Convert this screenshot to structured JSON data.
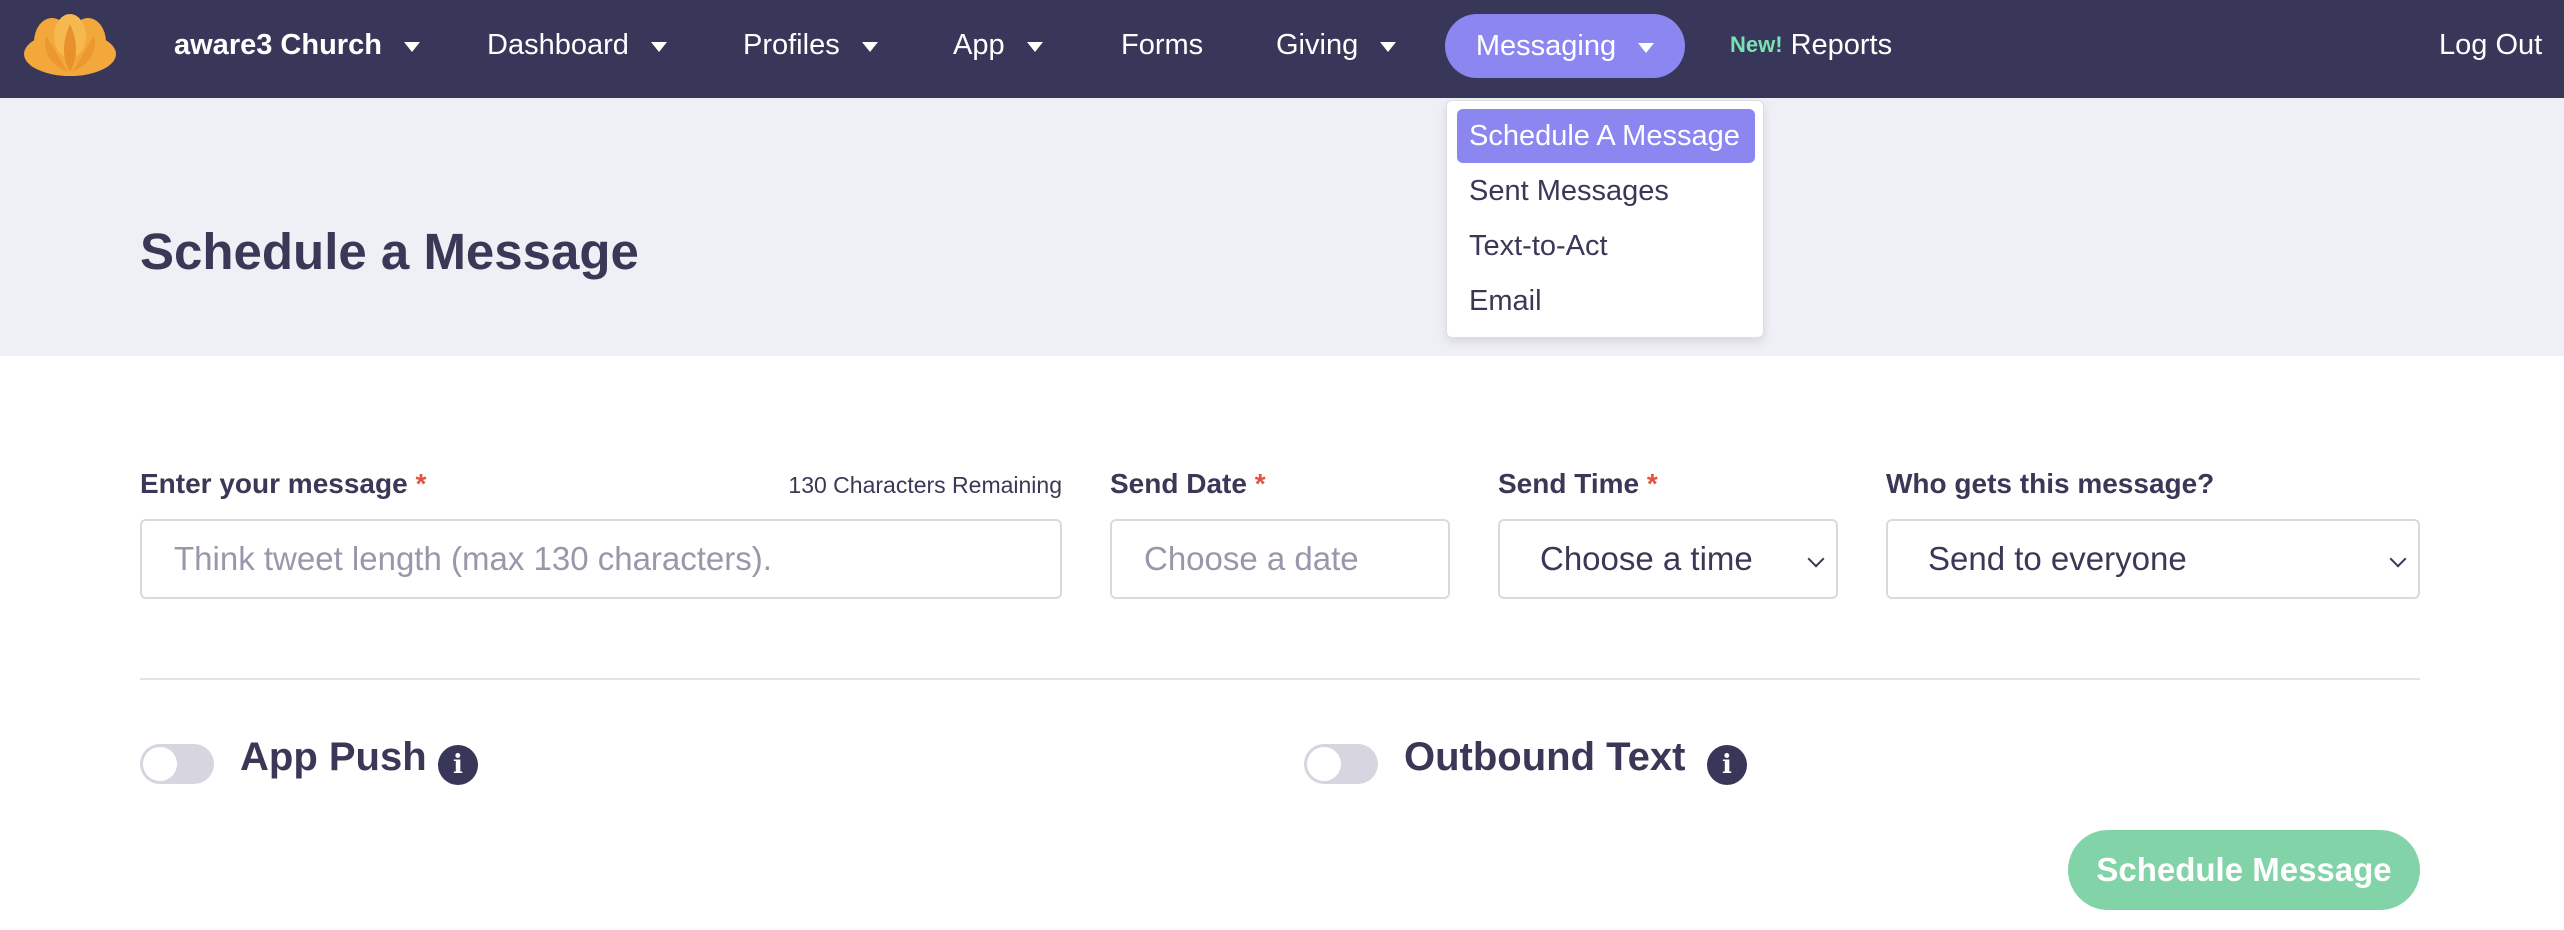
{
  "nav": {
    "brand": "aware3 Church",
    "dashboard": "Dashboard",
    "profiles": "Profiles",
    "app": "App",
    "forms": "Forms",
    "giving": "Giving",
    "messaging": "Messaging",
    "new_badge": "New!",
    "reports": "Reports",
    "logout": "Log Out"
  },
  "messaging_menu": {
    "items": [
      "Schedule A Message",
      "Sent Messages",
      "Text-to-Act",
      "Email"
    ],
    "selected": "Schedule A Message"
  },
  "page": {
    "title": "Schedule a Message"
  },
  "form": {
    "message": {
      "label": "Enter your message",
      "required_mark": "*",
      "char_count": "130 Characters Remaining",
      "placeholder": "Think tweet length (max 130 characters)."
    },
    "send_date": {
      "label": "Send Date",
      "required_mark": "*",
      "placeholder": "Choose a date"
    },
    "send_time": {
      "label": "Send Time",
      "required_mark": "*",
      "value": "Choose a time"
    },
    "recipients": {
      "label": "Who gets this message?",
      "value": "Send to everyone"
    }
  },
  "toggles": {
    "app_push": {
      "label": "App Push",
      "on": false
    },
    "outbound_text": {
      "label": "Outbound Text",
      "on": false
    }
  },
  "actions": {
    "schedule": "Schedule Message"
  },
  "colors": {
    "nav_bg": "#38375a",
    "accent": "#8b86f0",
    "success": "#82d4a8",
    "required": "#e0533f",
    "logo": "#f3a83c"
  }
}
